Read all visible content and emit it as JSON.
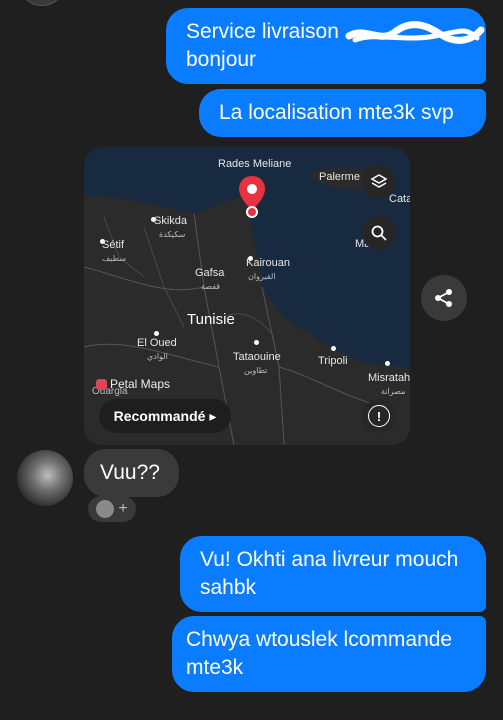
{
  "messages": {
    "outgoing_1": "Service livraison\nbonjour",
    "outgoing_2": "La localisation mte3k svp",
    "incoming_1": "Vuu??",
    "outgoing_3": "Vu! Okhti ana livreur mouch sahbk",
    "outgoing_4": "Chwya wtouslek lcommande mte3k"
  },
  "map": {
    "labels": {
      "rades": "Rades Meliane",
      "palerme": "Palerme",
      "catania": "Catan",
      "skikda": "Skikda",
      "skikda_ar": "سكيكدة",
      "setif": "Sétif",
      "setif_ar": "سطيف",
      "gafsa": "Gafsa",
      "gafsa_ar": "قفصة",
      "kairouan": "Kairouan",
      "kairouan_ar": "القيروان",
      "malta": "Ma",
      "tunisie": "Tunisie",
      "eloued": "El Oued",
      "eloued_ar": "الوادي",
      "tataouine": "Tataouine",
      "tataouine_ar": "تطاوين",
      "tripoli": "Tripoli",
      "misratah": "Misratah",
      "misratah_ar": "مصراتة",
      "ouargla": "Ouargla"
    },
    "provider": "Petal Maps",
    "recommend_label": "Recommandé ▸",
    "info_glyph": "!"
  },
  "reaction": {
    "plus": "+"
  },
  "icons": [
    "layers-icon",
    "search-icon",
    "info-icon",
    "share-icon",
    "location-pin-icon",
    "add-reaction-icon"
  ],
  "colors": {
    "outgoing": "#0a7cff",
    "incoming": "#3a3a3a",
    "background": "#1f1f1f",
    "pin": "#e8323f"
  }
}
